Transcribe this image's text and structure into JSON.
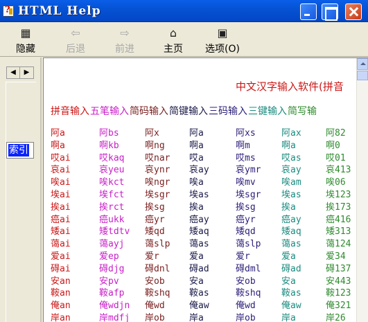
{
  "window": {
    "title": "HTML Help"
  },
  "toolbar": {
    "hide_label": "隐藏",
    "back_label": "后退",
    "forward_label": "前进",
    "home_label": "主页",
    "options_label": "选项(O)"
  },
  "left_pane": {
    "index_tab_label": "索引"
  },
  "content": {
    "title": "中文汉字输入软件(拼音",
    "columns": [
      {
        "label": "拼音输入",
        "color": "#cc1616"
      },
      {
        "label": "五笔输入",
        "color": "#c81ec8"
      },
      {
        "label": "简码输入",
        "color": "#7a1f1f"
      },
      {
        "label": "简键输入",
        "color": "#1a1a4a"
      },
      {
        "label": "三码输入",
        "color": "#2b1f78"
      },
      {
        "label": "三键输入",
        "color": "#1a8b7f"
      },
      {
        "label": "简写输",
        "color": "#2e8b2e"
      }
    ],
    "rows": [
      [
        "阿a",
        "阿bs",
        "阿x",
        "阿a",
        "阿xs",
        "阿ax",
        "阿82"
      ],
      [
        "啊a",
        "啊kb",
        "啊ng",
        "啊a",
        "啊m",
        "啊a",
        "啊0"
      ],
      [
        "哎ai",
        "哎kaq",
        "哎nar",
        "哎a",
        "哎ms",
        "哎as",
        "哎01"
      ],
      [
        "哀ai",
        "哀yeu",
        "哀ynr",
        "哀ay",
        "哀ymr",
        "哀ay",
        "哀413"
      ],
      [
        "唉ai",
        "唉kct",
        "唉ngr",
        "唉a",
        "唉mv",
        "唉am",
        "唉06"
      ],
      [
        "埃ai",
        "埃fct",
        "埃sgr",
        "埃as",
        "埃sgr",
        "埃as",
        "埃123"
      ],
      [
        "挨ai",
        "挨rct",
        "挨sg",
        "挨a",
        "挨sg",
        "挨a",
        "挨173"
      ],
      [
        "癌ai",
        "癌ukk",
        "癌yr",
        "癌ay",
        "癌yr",
        "癌ay",
        "癌416"
      ],
      [
        "矮ai",
        "矮tdtv",
        "矮qd",
        "矮aq",
        "矮qd",
        "矮aq",
        "矮313"
      ],
      [
        "蔼ai",
        "蔼ayj",
        "蔼slp",
        "蔼as",
        "蔼slp",
        "蔼as",
        "蔼124"
      ],
      [
        "爱ai",
        "爱ep",
        "爱r",
        "爱a",
        "爱r",
        "爱a",
        "爱34"
      ],
      [
        "碍ai",
        "碍djg",
        "碍dnl",
        "碍ad",
        "碍dml",
        "碍ad",
        "碍137"
      ],
      [
        "安an",
        "安pv",
        "安ob",
        "安a",
        "安ob",
        "安a",
        "安443"
      ],
      [
        "鞍an",
        "鞍afp",
        "鞍shq",
        "鞍as",
        "鞍shq",
        "鞍as",
        "鞍123"
      ],
      [
        "俺an",
        "俺wdjn",
        "俺wd",
        "俺aw",
        "俺wd",
        "俺aw",
        "俺321"
      ],
      [
        "岸an",
        "岸mdfj",
        "岸ob",
        "岸a",
        "岸ob",
        "岸a",
        "岸26"
      ]
    ]
  }
}
